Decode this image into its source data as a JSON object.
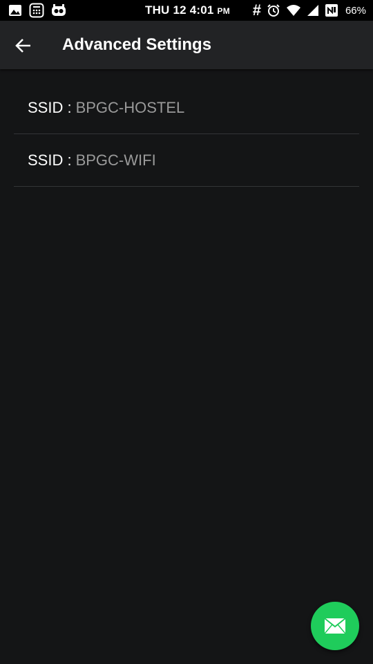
{
  "status_bar": {
    "day": "THU 12",
    "time": "4:01",
    "ampm": "PM",
    "hash": "#",
    "battery": "66%",
    "icons_left": [
      "image-icon",
      "calculator-icon",
      "cyanogen-mascot-icon"
    ],
    "icons_right": [
      "hash-icon",
      "alarm-icon",
      "wifi-icon",
      "signal-icon",
      "nfc-icon"
    ]
  },
  "app_bar": {
    "back_icon": "arrow-left-icon",
    "title": "Advanced Settings"
  },
  "ssid_list": {
    "items": [
      {
        "key": "SSID :",
        "value": "BPGC-HOSTEL"
      },
      {
        "key": "SSID :",
        "value": "BPGC-WIFI"
      }
    ]
  },
  "fab": {
    "icon": "mail-icon"
  },
  "colors": {
    "background": "#141516",
    "app_bar": "#222325",
    "status_bar": "#000000",
    "fab": "#1fcc5b",
    "value_text": "#9a9a9a"
  }
}
